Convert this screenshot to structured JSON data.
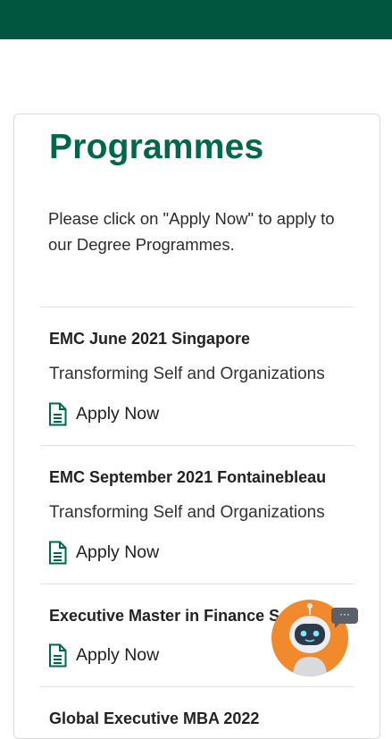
{
  "header": {
    "color": "#00563f"
  },
  "page": {
    "title": "Programmes",
    "intro": "Please click on \"Apply Now\" to apply to our Degree Programmes."
  },
  "programmes": [
    {
      "title": "EMC June 2021 Singapore",
      "subtitle": "Transforming Self and Organizations",
      "apply_label": "Apply Now"
    },
    {
      "title": "EMC September 2021 Fontainebleau",
      "subtitle": "Transforming Self and Organizations",
      "apply_label": "Apply Now"
    },
    {
      "title": "Executive Master in Finance S",
      "subtitle": "",
      "apply_label": "Apply Now"
    },
    {
      "title": "Global Executive MBA 2022",
      "subtitle": "",
      "apply_label": ""
    }
  ],
  "chatbot": {
    "bubble_text": "···",
    "color": "#f08a2c"
  },
  "colors": {
    "accent": "#00684a",
    "icon": "#00684a"
  },
  "icons": {
    "apply": "document-icon",
    "chat": "robot-icon"
  }
}
